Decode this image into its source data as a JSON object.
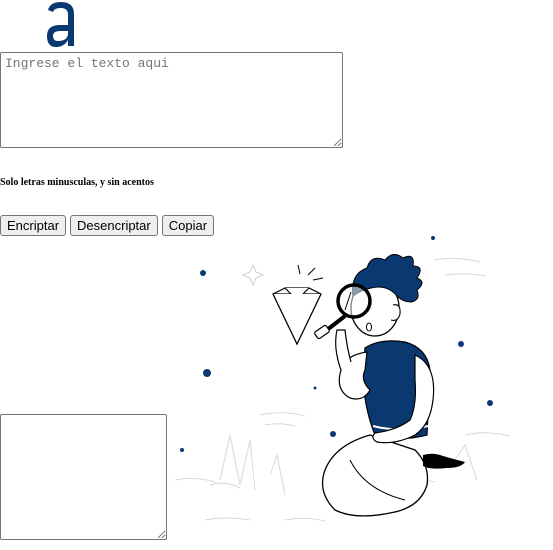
{
  "logo": {
    "icon": "alura-logo-a",
    "color": "#0a3871"
  },
  "input": {
    "placeholder": "Ingrese el texto aqui",
    "value": ""
  },
  "hint": {
    "text": "Solo letras minusculas, y sin acentos"
  },
  "buttons": {
    "encrypt_label": "Encriptar",
    "decrypt_label": "Desencriptar",
    "copy_label": "Copiar"
  },
  "output": {
    "value": ""
  },
  "illustration": {
    "icon": "person-magnifying-glass-illustration",
    "accent": "#0a3871"
  }
}
